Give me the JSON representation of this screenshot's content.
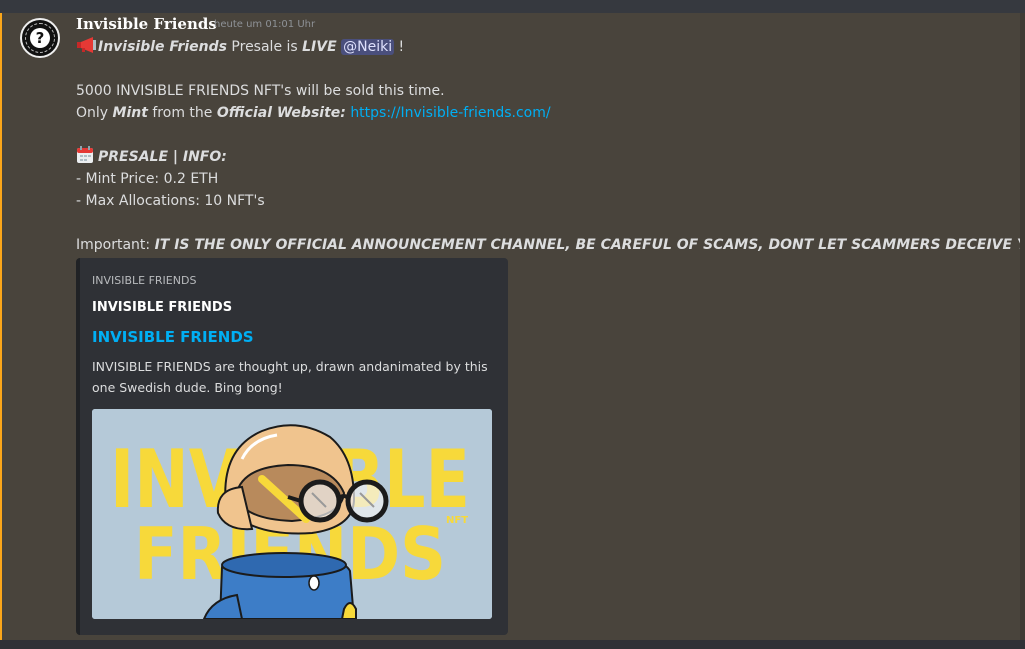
{
  "message": {
    "author": "Invisible Friends",
    "timestamp": "heute um 01:01 Uhr",
    "line1": {
      "icon": "megaphone-icon",
      "name": "Invisible Friends",
      "text_a": " Presale is ",
      "live": "LIVE",
      "mention": "@Neiki",
      "text_b": " !"
    },
    "line2": "5000 INVISIBLE FRIENDS NFT's will be sold this time.",
    "line3": {
      "prefix": "Only ",
      "mint": "Mint",
      "text_a": " from the ",
      "official": "Official Website:",
      "url": "https://Invisible-friends.com/"
    },
    "presale": {
      "icon": "calendar-icon",
      "heading": "PRESALE | INFO:",
      "mint_price": "- Mint Price: 0.2 ETH",
      "max_alloc": "- Max Allocations: 10 NFT's"
    },
    "important": {
      "label": "Important: ",
      "text": "IT IS THE ONLY OFFICIAL ANNOUNCEMENT CHANNEL, BE CAREFUL OF SCAMS, DONT LET SCAMMERS DECEIVE YOU!!!"
    }
  },
  "embed": {
    "provider": "INVISIBLE FRIENDS",
    "author": "INVISIBLE FRIENDS",
    "title": "INVISIBLE FRIENDS",
    "description": "INVISIBLE FRIENDS are thought up, drawn andanimated by this one Swedish dude. Bing bong!",
    "image": {
      "line1": "INVISIBLE",
      "line2": "FRIENDS",
      "badge": "NFT",
      "bg_color": "#b5c9d8",
      "text_color": "#f7d93a"
    }
  },
  "colors": {
    "background": "#36393f",
    "highlight_bg": "#49443c",
    "highlight_border": "#faa61a",
    "link": "#00aff4",
    "mention_bg": "#4a4f7d"
  }
}
